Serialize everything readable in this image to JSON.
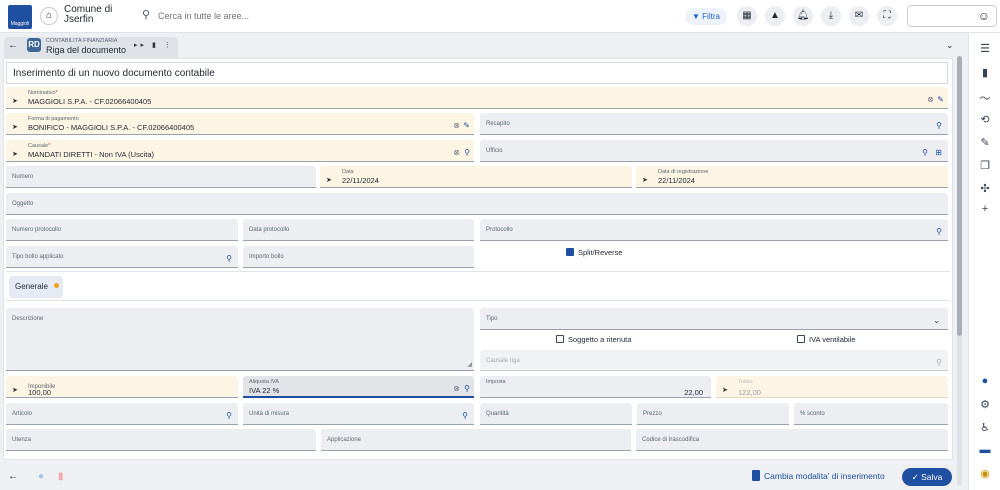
{
  "topbar": {
    "logo_text": "Maggioli",
    "municipality_line1": "Comune di",
    "municipality_line2": "Jserfin",
    "search_placeholder": "Cerca in tutte le aree...",
    "filter_label": "Filtra",
    "user_icon": "user-circle-icon"
  },
  "breadcrumb": {
    "badge": "RD",
    "module": "CONTABILITÀ FINANZIARIA",
    "title": "Riga del documento"
  },
  "form": {
    "title": "Inserimento di un nuovo documento contabile",
    "nominativo": {
      "label": "Nominativo",
      "value": "MAGGIOLI S.P.A. - CF.02066400405"
    },
    "forma_pagamento": {
      "label": "Forma di pagamento",
      "value": "BONIFICO - MAGGIOLI S.P.A. - CF.02066400405"
    },
    "recapito": {
      "label": "Recapito"
    },
    "causale": {
      "label": "Causale",
      "value": "MANDATI DIRETTI - Non IVA (Uscita)"
    },
    "ufficio": {
      "label": "Ufficio"
    },
    "numero": {
      "label": "Numero"
    },
    "data": {
      "label": "Data",
      "value": "22/11/2024"
    },
    "data_registrazione": {
      "label": "Data di registrazione",
      "value": "22/11/2024"
    },
    "oggetto": {
      "label": "Oggetto"
    },
    "numero_protocollo": {
      "label": "Numero protocollo"
    },
    "data_protocollo": {
      "label": "Data protocollo"
    },
    "protocollo": {
      "label": "Protocollo"
    },
    "tipo_bollo": {
      "label": "Tipo bollo applicato"
    },
    "importo_bollo": {
      "label": "Importo bollo"
    },
    "split_reverse": {
      "label": "Split/Reverse",
      "checked": true
    }
  },
  "tabs": [
    {
      "label": "Generale"
    }
  ],
  "riga": {
    "descrizione": {
      "label": "Descrizione"
    },
    "tipo": {
      "label": "Tipo"
    },
    "soggetto_ritenuta": {
      "label": "Soggetto a ritenuta",
      "checked": false
    },
    "iva_ventilabile": {
      "label": "IVA ventilabile",
      "checked": false
    },
    "causale_riga": {
      "label": "Causale riga"
    },
    "imponibile": {
      "label": "Imponibile",
      "value": "100,00"
    },
    "aliquota_iva": {
      "label": "Aliquota IVA",
      "value": "IVA 22 %"
    },
    "imposta": {
      "label": "Imposta",
      "value": "22,00"
    },
    "totale": {
      "label": "Totale",
      "value": "122,00"
    },
    "articolo": {
      "label": "Articolo"
    },
    "unita_misura": {
      "label": "Unità di misura"
    },
    "quantita": {
      "label": "Quantità"
    },
    "prezzo": {
      "label": "Prezzo"
    },
    "sconto": {
      "label": "% sconto"
    },
    "utenza": {
      "label": "Utenza"
    },
    "applicazione": {
      "label": "Applicazione"
    },
    "codice_trascodifica": {
      "label": "Codice di trascodifica"
    }
  },
  "footer": {
    "switch_mode": "Cambia modalita' di inserimento",
    "save": "Salva"
  },
  "colors": {
    "accent": "#1f4fa0",
    "required_field_bg": "#fdf5e3",
    "field_bg": "#eceef1",
    "required_star": "#d9301c",
    "tab_dot": "#f0a020"
  }
}
